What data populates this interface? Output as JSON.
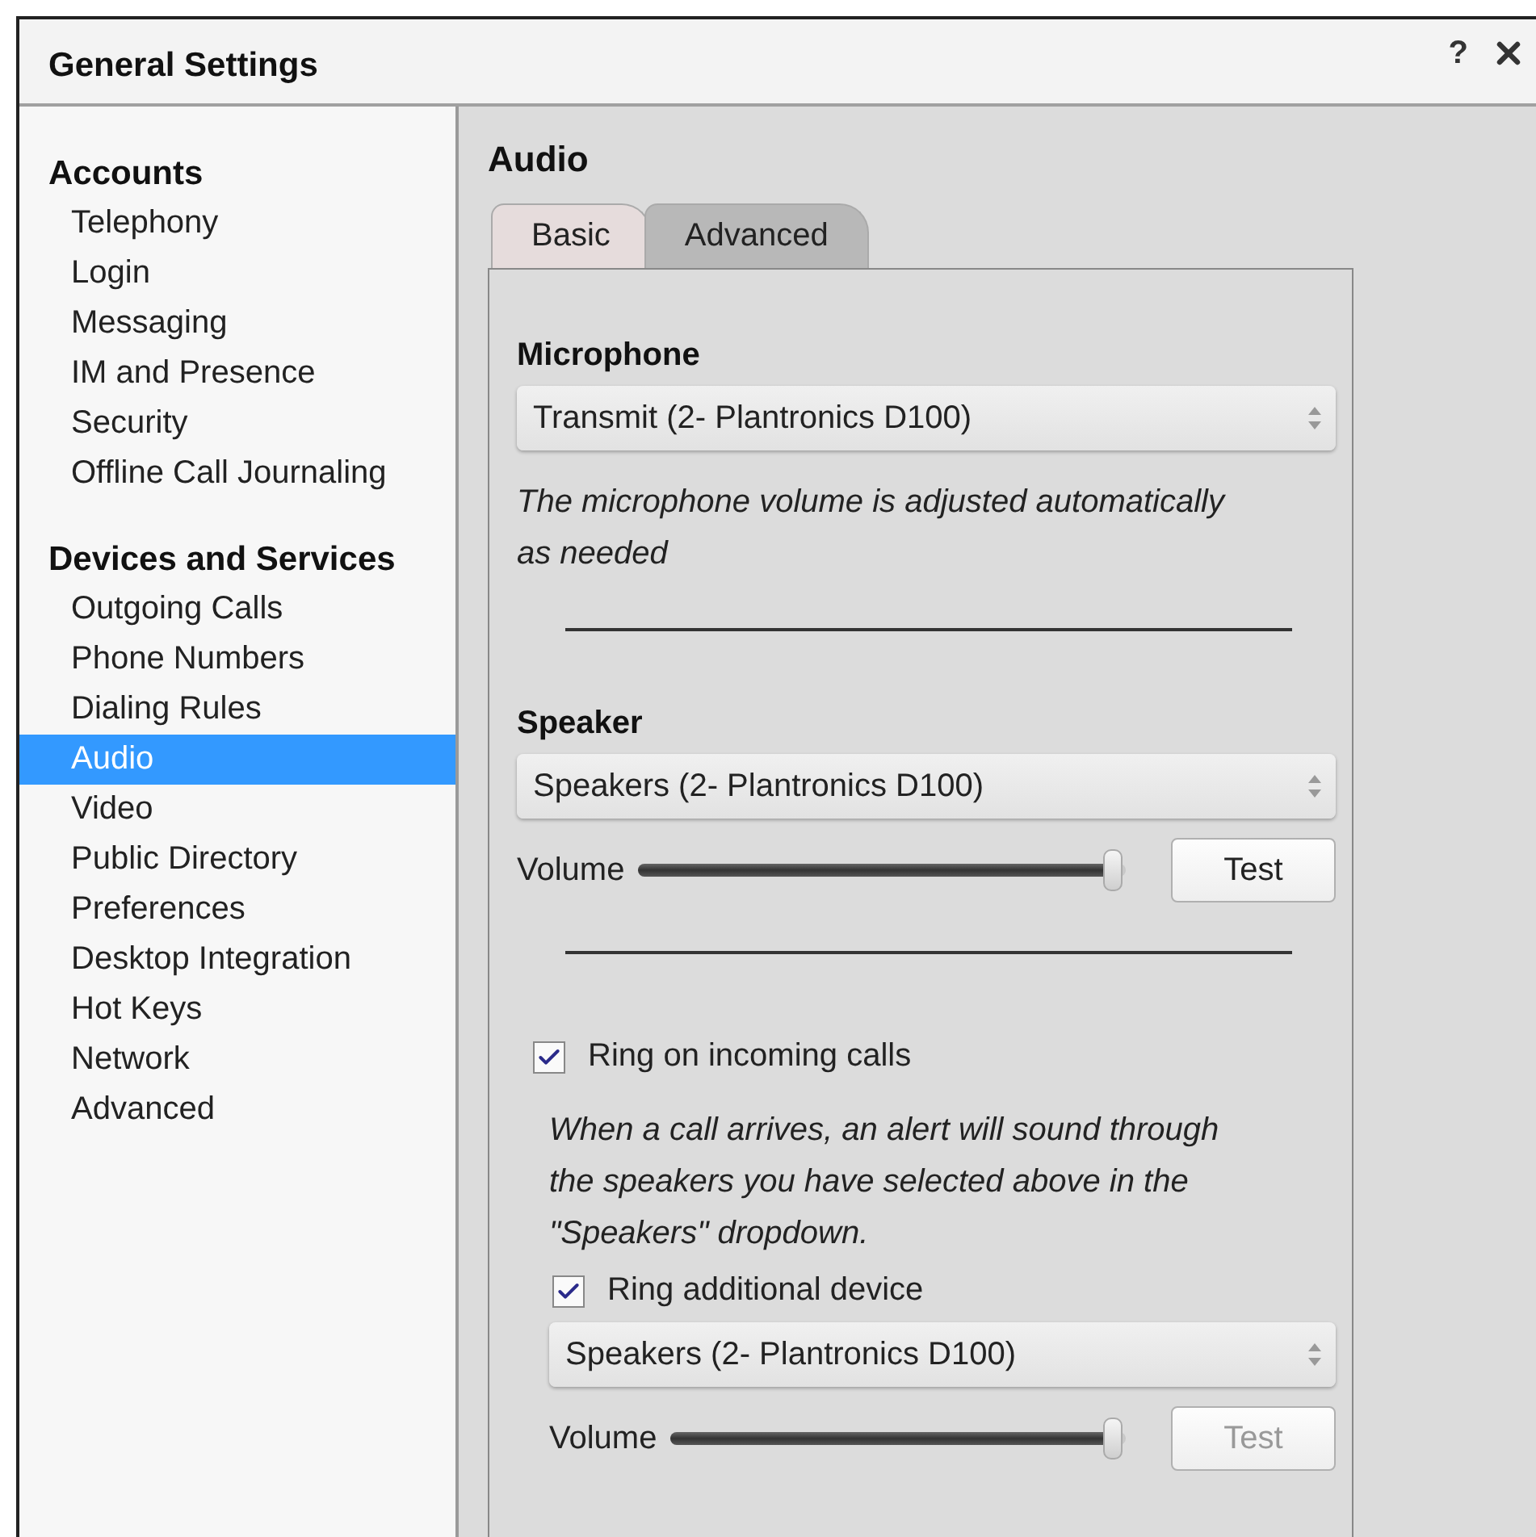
{
  "window": {
    "title": "General Settings",
    "help": "?"
  },
  "sidebar": {
    "sections": [
      {
        "heading": "Accounts",
        "items": [
          {
            "label": "Telephony",
            "selected": false
          },
          {
            "label": "Login",
            "selected": false
          },
          {
            "label": "Messaging",
            "selected": false
          },
          {
            "label": "IM and Presence",
            "selected": false
          },
          {
            "label": "Security",
            "selected": false
          },
          {
            "label": "Offline Call Journaling",
            "selected": false
          }
        ]
      },
      {
        "heading": "Devices and Services",
        "items": [
          {
            "label": "Outgoing Calls",
            "selected": false
          },
          {
            "label": "Phone Numbers",
            "selected": false
          },
          {
            "label": "Dialing Rules",
            "selected": false
          },
          {
            "label": "Audio",
            "selected": true
          },
          {
            "label": "Video",
            "selected": false
          },
          {
            "label": "Public Directory",
            "selected": false
          },
          {
            "label": "Preferences",
            "selected": false
          },
          {
            "label": "Desktop Integration",
            "selected": false
          },
          {
            "label": "Hot Keys",
            "selected": false
          },
          {
            "label": "Network",
            "selected": false
          },
          {
            "label": "Advanced",
            "selected": false
          }
        ]
      }
    ]
  },
  "panel": {
    "title": "Audio",
    "tabs": [
      {
        "label": "Basic",
        "selected": true
      },
      {
        "label": "Advanced",
        "selected": false
      }
    ],
    "content": [
      {
        "kind": "heading",
        "text": "Microphone"
      },
      {
        "kind": "select",
        "value": "Transmit (2- Plantronics D100)"
      },
      {
        "kind": "note",
        "text": "The microphone volume is adjusted automatically as needed"
      },
      {
        "kind": "divider"
      },
      {
        "kind": "heading",
        "text": "Speaker"
      },
      {
        "kind": "select",
        "value": "Speakers (2- Plantronics D100)"
      },
      {
        "kind": "volume",
        "label": "Volume",
        "level": 0.98,
        "button": {
          "label": "Test",
          "disabled": false
        }
      },
      {
        "kind": "divider"
      },
      {
        "kind": "checkbox",
        "label": "Ring on incoming calls",
        "checked": true,
        "children": [
          {
            "kind": "note",
            "text": "When a call arrives, an alert will sound through the speakers you have selected above in the \"Speakers\" dropdown."
          },
          {
            "kind": "checkbox",
            "label": "Ring additional device",
            "checked": true
          },
          {
            "kind": "select",
            "value": "Speakers (2- Plantronics D100)"
          },
          {
            "kind": "volume",
            "label": "Volume",
            "level": 0.98,
            "button": {
              "label": "Test",
              "disabled": true
            }
          }
        ]
      }
    ]
  }
}
